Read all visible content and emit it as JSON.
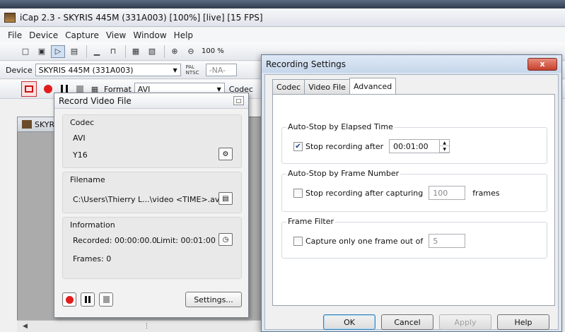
{
  "app": {
    "title": "iCap 2.3 - SKYRIS 445M (331A003) [100%] [live] [15 FPS]",
    "menu": [
      "File",
      "Device",
      "Capture",
      "View",
      "Window",
      "Help"
    ],
    "zoom": "100 %",
    "device_label": "Device",
    "device_value": "SKYRIS 445M (331A003)",
    "pal_label": "PAL NTSC",
    "na_value": "-NA-",
    "format_label": "Format",
    "format_value": "AVI",
    "codec_label": "Codec",
    "video_tab": "SKYR"
  },
  "record_panel": {
    "title": "Record Video File",
    "codec_group": "Codec",
    "codec_value": "AVI",
    "codec_sub": "Y16",
    "filename_group": "Filename",
    "filename_value": "C:\\Users\\Thierry L...\\video <TIME>.avi",
    "info_group": "Information",
    "recorded": "Recorded: 00:00:00.0",
    "limit": "Limit: 00:01:00",
    "frames": "Frames: 0",
    "settings_button": "Settings..."
  },
  "settings_dialog": {
    "title": "Recording Settings",
    "close_label": "x",
    "tabs": [
      "Codec",
      "Video File",
      "Advanced"
    ],
    "elapsed_group": "Auto-Stop by Elapsed Time",
    "elapsed_checkbox": "Stop recording after",
    "elapsed_checked": true,
    "elapsed_value": "00:01:00",
    "frame_group": "Auto-Stop by Frame Number",
    "frame_checkbox": "Stop recording after capturing",
    "frame_checked": false,
    "frame_value": "100",
    "frame_unit": "frames",
    "filter_group": "Frame Filter",
    "filter_checkbox": "Capture only one frame out of",
    "filter_checked": false,
    "filter_value": "5",
    "ok": "OK",
    "cancel": "Cancel",
    "apply": "Apply",
    "help": "Help"
  }
}
